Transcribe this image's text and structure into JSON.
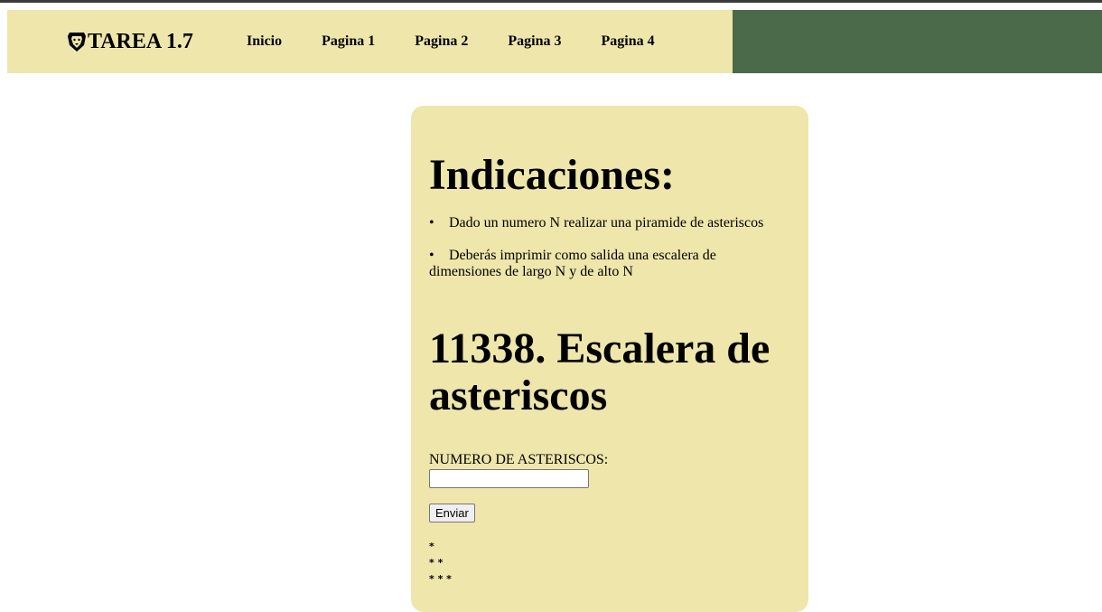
{
  "brand": {
    "name": "TAREA 1.7",
    "icon": "lion-shield-icon"
  },
  "nav": {
    "items": [
      {
        "label": "Inicio"
      },
      {
        "label": "Pagina 1"
      },
      {
        "label": "Pagina 2"
      },
      {
        "label": "Pagina 3"
      },
      {
        "label": "Pagina 4"
      }
    ]
  },
  "colors": {
    "nav_bg": "#eee6ab",
    "nav_dark": "#4b6a4a",
    "card_bg": "#eee6ab"
  },
  "main": {
    "indicaciones_heading": "Indicaciones:",
    "indicaciones": [
      "Dado un numero N realizar una piramide de asteriscos",
      "Deberás imprimir como salida una escalera de dimensiones de largo N y de alto N"
    ],
    "problem_title": "11338. Escalera de asteriscos",
    "form": {
      "label": "NUMERO DE ASTERISCOS:",
      "input_value": "",
      "submit_label": "Enviar"
    },
    "output_lines": [
      "*",
      "* *",
      "* * *"
    ]
  }
}
